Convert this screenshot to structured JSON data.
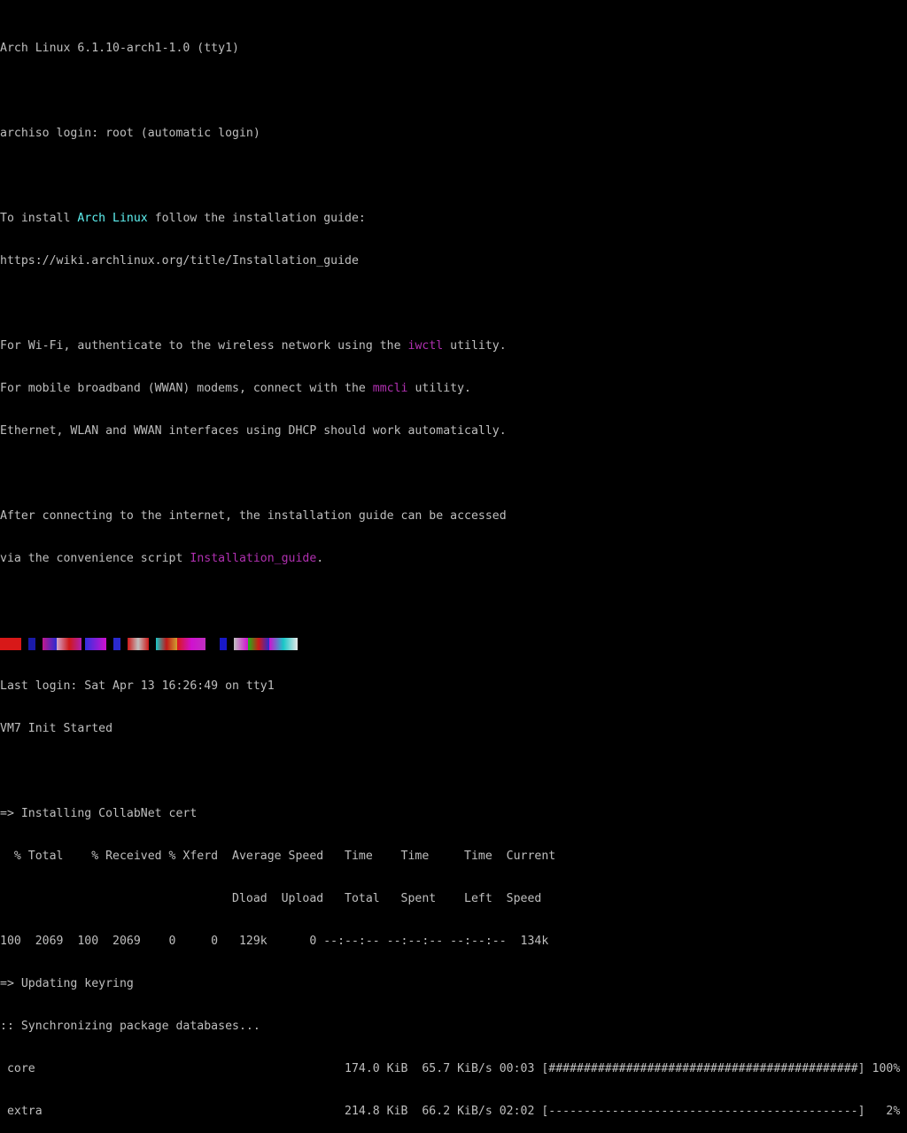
{
  "lines": {
    "l1": "Arch Linux 6.1.10-arch1-1.0 (tty1)",
    "l2": "archiso login: root (automatic login)",
    "l3a": "To install ",
    "l3b": "Arch Linux",
    "l3c": " follow the installation guide:",
    "l4": "https://wiki.archlinux.org/title/Installation_guide",
    "l5a": "For Wi-Fi, authenticate to the wireless network using the ",
    "l5b": "iwctl",
    "l5c": " utility.",
    "l6a": "For mobile broadband (WWAN) modems, connect with the ",
    "l6b": "mmcli",
    "l6c": " utility.",
    "l7": "Ethernet, WLAN and WWAN interfaces using DHCP should work automatically.",
    "l8": "After connecting to the internet, the installation guide can be accessed",
    "l9a": "via the convenience script ",
    "l9b": "Installation_guide",
    "l9c": ".",
    "l10": "Last login: Sat Apr 13 16:26:49 on tty1",
    "l11": "VM7 Init Started",
    "l12": "=> Installing CollabNet cert",
    "l13": "  % Total    % Received % Xferd  Average Speed   Time    Time     Time  Current",
    "l14": "                                 Dload  Upload   Total   Spent    Left  Speed",
    "l15": "100  2069  100  2069    0     0   129k      0 --:--:-- --:--:-- --:--:--  134k",
    "l16": "=> Updating keyring",
    "l17": ":: Synchronizing package databases...",
    "l18": " core                                            174.0 KiB  65.7 KiB/s 00:03 [############################################] 100%",
    "l19": " extra                                           214.8 KiB  66.2 KiB/s 02:02 [--------------------------------------------]   2%"
  },
  "colors": {
    "text": "#bfbfbf",
    "highlight_cyan": "#5ff2f2",
    "highlight_magenta": "#b030b0",
    "background": "#000000"
  }
}
